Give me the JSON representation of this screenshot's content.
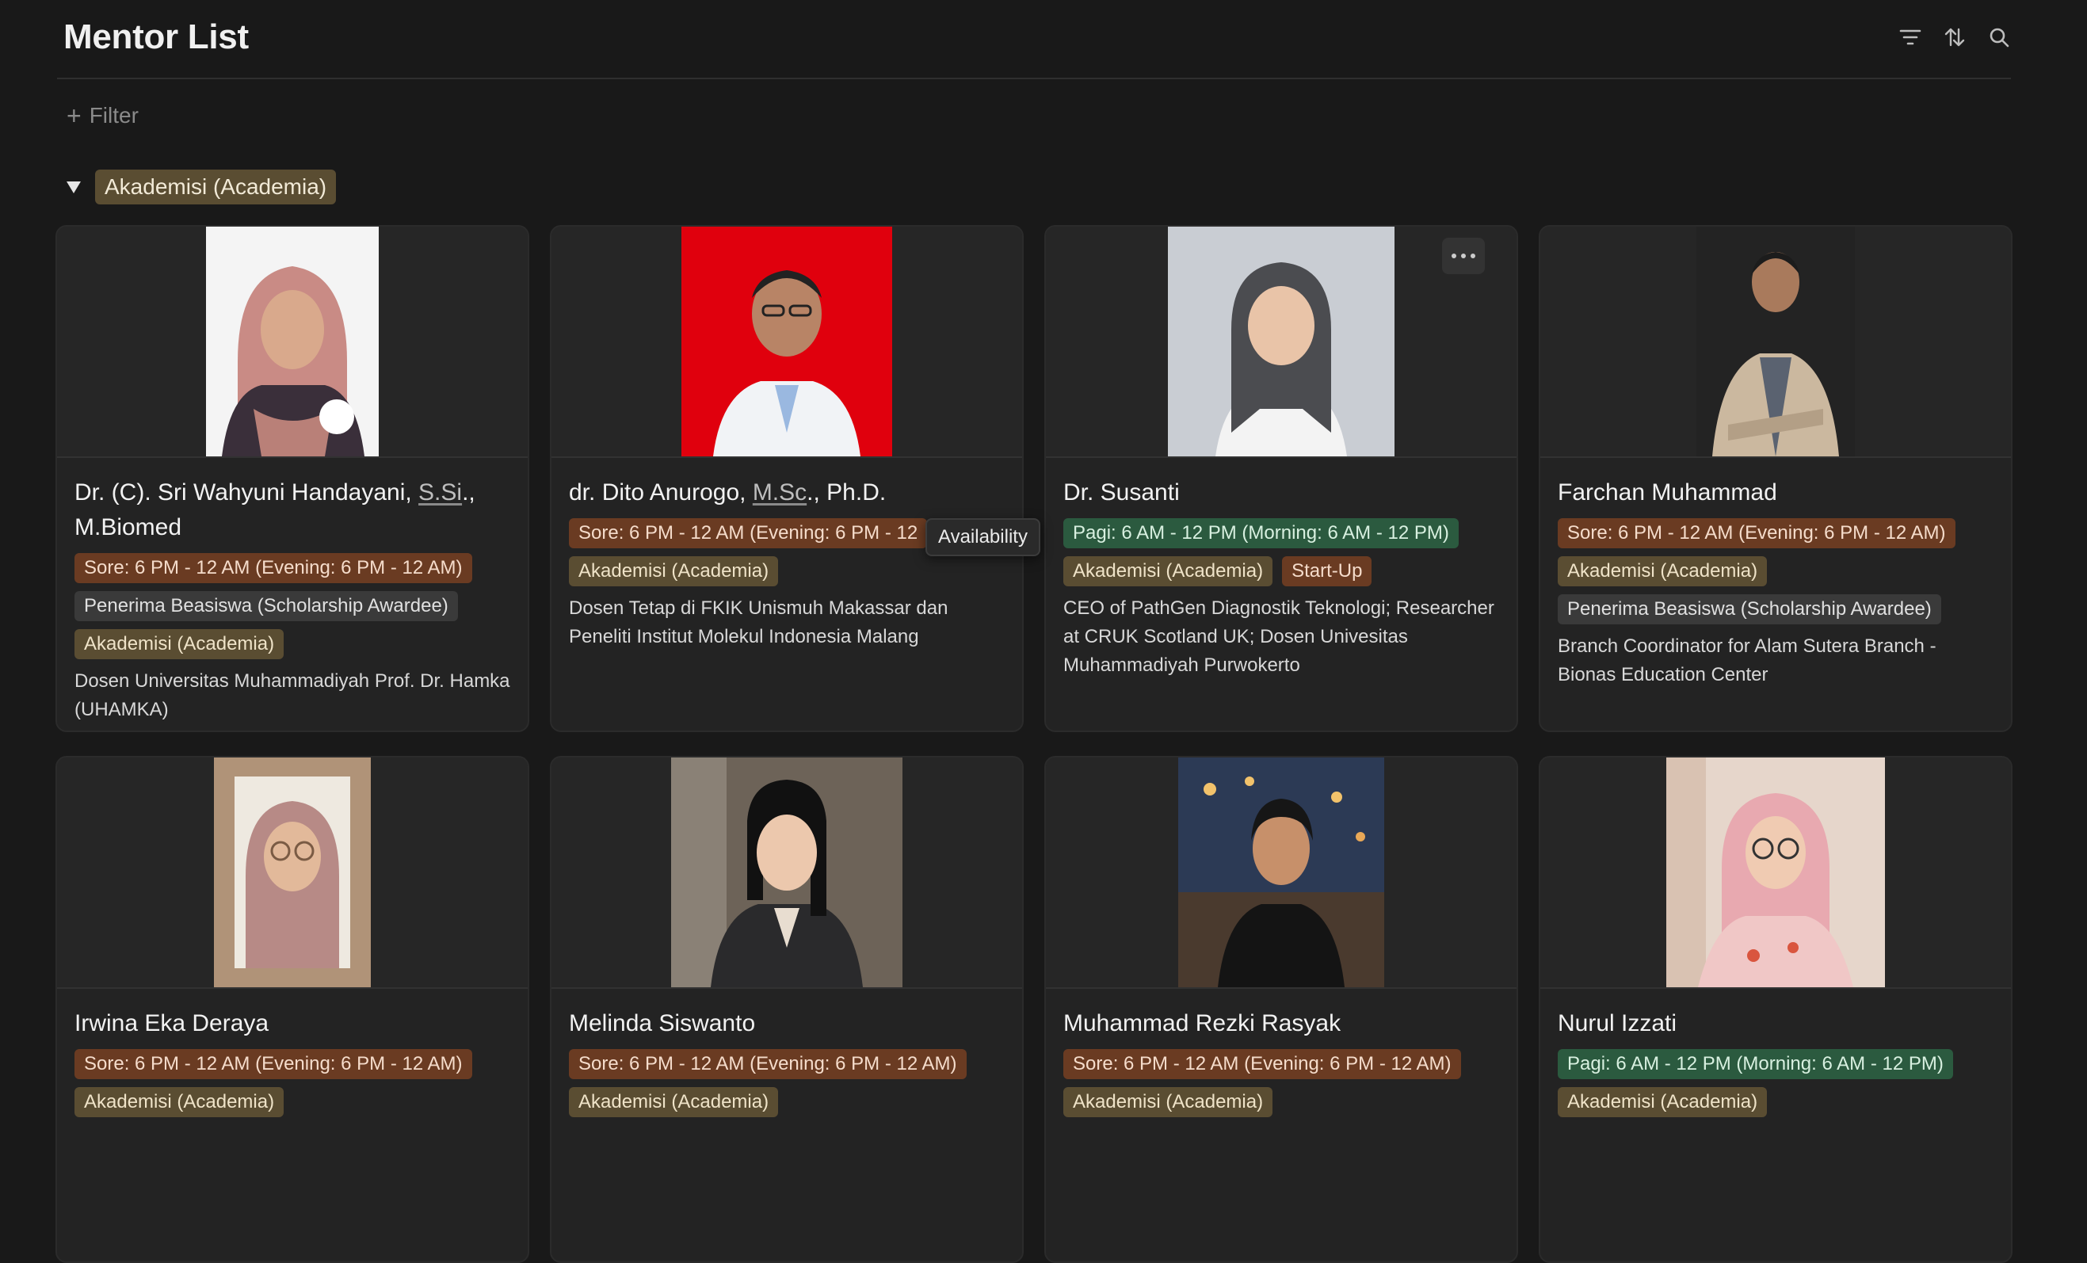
{
  "header": {
    "title": "Mentor List"
  },
  "toolbar": {
    "filter_label": "Filter"
  },
  "group": {
    "label": "Akademisi (Academia)"
  },
  "tooltip": {
    "text": "Availability"
  },
  "colors": {
    "evening": "#6a3b22",
    "morning": "#2b5a3f",
    "academia": "#5a4d32",
    "background": "#191919"
  },
  "mentors": [
    {
      "name_a": "Dr. (C). Sri Wahyuni Handayani, ",
      "name_u": "S.Si",
      "name_b": "., M.Biomed",
      "availability": "Sore: 6 PM - 12 AM (Evening: 6 PM - 12 AM)",
      "tag2": "Penerima Beasiswa (Scholarship Awardee)",
      "tag3": "Akademisi (Academia)",
      "desc": "Dosen Universitas Muhammadiyah Prof. Dr. Hamka (UHAMKA)"
    },
    {
      "name_a": "dr. Dito Anurogo, ",
      "name_u": "M.Sc",
      "name_b": "., Ph.D.",
      "availability": "Sore: 6 PM - 12 AM (Evening: 6 PM - 12",
      "tag2": "Akademisi (Academia)",
      "desc": "Dosen Tetap di FKIK Unismuh Makassar dan Peneliti Institut Molekul Indonesia Malang"
    },
    {
      "name": "Dr. Susanti",
      "availability": "Pagi: 6 AM - 12 PM (Morning: 6 AM - 12 PM)",
      "tag2": "Akademisi (Academia)",
      "tag3": "Start-Up",
      "desc": "CEO of PathGen Diagnostik Teknologi; Researcher at CRUK Scotland UK; Dosen Univesitas Muhammadiyah Purwokerto"
    },
    {
      "name": "Farchan Muhammad",
      "availability": "Sore: 6 PM - 12 AM (Evening: 6 PM - 12 AM)",
      "tag2": "Akademisi (Academia)",
      "tag3": "Penerima Beasiswa (Scholarship Awardee)",
      "desc": "Branch Coordinator for Alam Sutera Branch - Bionas Education Center"
    },
    {
      "name": "Irwina Eka Deraya",
      "availability": "Sore: 6 PM - 12 AM (Evening: 6 PM - 12 AM)",
      "tag2": "Akademisi (Academia)"
    },
    {
      "name": "Melinda Siswanto",
      "availability": "Sore: 6 PM - 12 AM (Evening: 6 PM - 12 AM)",
      "tag2": "Akademisi (Academia)"
    },
    {
      "name": "Muhammad Rezki Rasyak",
      "availability": "Sore: 6 PM - 12 AM (Evening: 6 PM - 12 AM)",
      "tag2": "Akademisi (Academia)"
    },
    {
      "name": "Nurul Izzati",
      "availability": "Pagi: 6 AM - 12 PM (Morning: 6 AM - 12 PM)",
      "tag2": "Akademisi (Academia)"
    }
  ]
}
